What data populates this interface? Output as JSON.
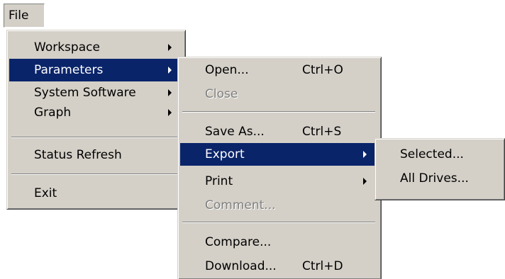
{
  "menubar": {
    "file_label": "File"
  },
  "file_menu": {
    "workspace": "Workspace",
    "parameters": "Parameters",
    "system_software": "System Software",
    "graph": "Graph",
    "status_refresh": "Status Refresh",
    "exit": "Exit"
  },
  "parameters_menu": {
    "open": {
      "label": "Open...",
      "shortcut": "Ctrl+O"
    },
    "close": {
      "label": "Close"
    },
    "save_as": {
      "label": "Save As...",
      "shortcut": "Ctrl+S"
    },
    "export": {
      "label": "Export"
    },
    "print": {
      "label": "Print"
    },
    "comment": {
      "label": "Comment..."
    },
    "compare": {
      "label": "Compare..."
    },
    "download": {
      "label": "Download...",
      "shortcut": "Ctrl+D"
    }
  },
  "export_menu": {
    "selected": "Selected...",
    "all_drives": "All Drives..."
  },
  "colors": {
    "menu_background": "#d4d0c8",
    "highlight": "#0a246a",
    "disabled_text": "#808080"
  },
  "icons": {
    "submenu_arrow": "submenu-arrow-icon"
  }
}
